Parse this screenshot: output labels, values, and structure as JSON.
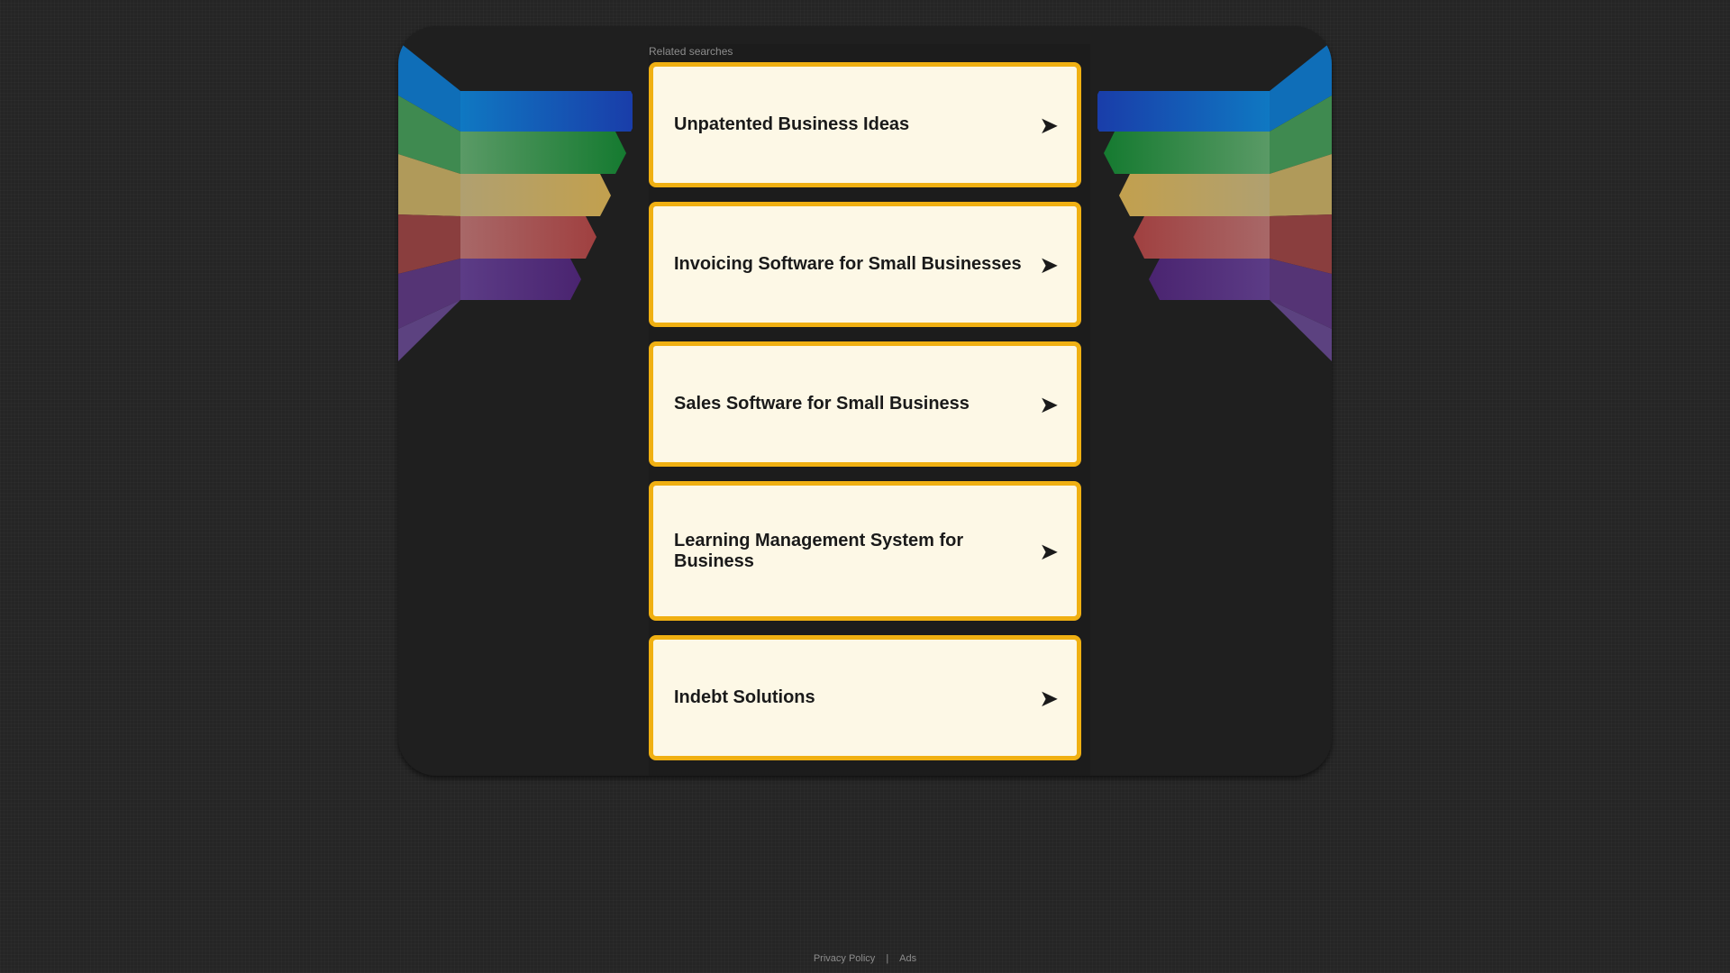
{
  "related_searches_label": "Related searches",
  "links": [
    {
      "label": "Unpatented Business Ideas",
      "arrow": "➤"
    },
    {
      "label": "Invoicing Software for Small Businesses",
      "arrow": "➤"
    },
    {
      "label": "Sales Software for Small Business",
      "arrow": "➤"
    },
    {
      "label": "Learning Management System for Business",
      "arrow": "➤"
    },
    {
      "label": "Indebt Solutions",
      "arrow": "➤"
    }
  ],
  "footer": {
    "privacy_policy": "Privacy Policy",
    "separator": "|",
    "ads": "Ads"
  },
  "colors": {
    "card_background": "#fdf8e6",
    "card_border": "#f0b012",
    "ribbon_blue": "#1060b0",
    "ribbon_green": "#2a8a3a",
    "ribbon_gold": "#b89a4a",
    "ribbon_red": "#a04848",
    "ribbon_purple": "#4a2a7a"
  }
}
